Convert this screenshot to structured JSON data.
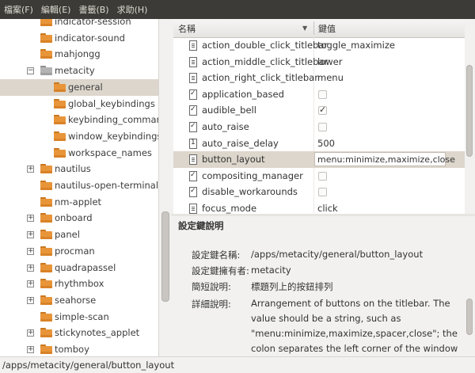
{
  "menu": [
    "檔案(F)",
    "編輯(E)",
    "書籤(B)",
    "求助(H)"
  ],
  "tree": [
    {
      "label": "indicator-session",
      "depth": 1,
      "expander": "none",
      "folder": "orange",
      "selected": false
    },
    {
      "label": "indicator-sound",
      "depth": 1,
      "expander": "none",
      "folder": "orange",
      "selected": false
    },
    {
      "label": "mahjongg",
      "depth": 1,
      "expander": "none",
      "folder": "orange",
      "selected": false
    },
    {
      "label": "metacity",
      "depth": 1,
      "expander": "minus",
      "folder": "gray",
      "selected": false
    },
    {
      "label": "general",
      "depth": 2,
      "expander": "none",
      "folder": "orange",
      "selected": true
    },
    {
      "label": "global_keybindings",
      "depth": 2,
      "expander": "none",
      "folder": "orange",
      "selected": false
    },
    {
      "label": "keybinding_commands",
      "depth": 2,
      "expander": "none",
      "folder": "orange",
      "selected": false
    },
    {
      "label": "window_keybindings",
      "depth": 2,
      "expander": "none",
      "folder": "orange",
      "selected": false
    },
    {
      "label": "workspace_names",
      "depth": 2,
      "expander": "none",
      "folder": "orange",
      "selected": false
    },
    {
      "label": "nautilus",
      "depth": 1,
      "expander": "plus",
      "folder": "orange",
      "selected": false
    },
    {
      "label": "nautilus-open-terminal",
      "depth": 1,
      "expander": "none",
      "folder": "orange",
      "selected": false
    },
    {
      "label": "nm-applet",
      "depth": 1,
      "expander": "none",
      "folder": "orange",
      "selected": false
    },
    {
      "label": "onboard",
      "depth": 1,
      "expander": "plus",
      "folder": "orange",
      "selected": false
    },
    {
      "label": "panel",
      "depth": 1,
      "expander": "plus",
      "folder": "orange",
      "selected": false
    },
    {
      "label": "procman",
      "depth": 1,
      "expander": "plus",
      "folder": "orange",
      "selected": false
    },
    {
      "label": "quadrapassel",
      "depth": 1,
      "expander": "plus",
      "folder": "orange",
      "selected": false
    },
    {
      "label": "rhythmbox",
      "depth": 1,
      "expander": "plus",
      "folder": "orange",
      "selected": false
    },
    {
      "label": "seahorse",
      "depth": 1,
      "expander": "plus",
      "folder": "orange",
      "selected": false
    },
    {
      "label": "simple-scan",
      "depth": 1,
      "expander": "none",
      "folder": "orange",
      "selected": false
    },
    {
      "label": "stickynotes_applet",
      "depth": 1,
      "expander": "plus",
      "folder": "orange",
      "selected": false
    },
    {
      "label": "tomboy",
      "depth": 1,
      "expander": "plus",
      "folder": "orange",
      "selected": false
    }
  ],
  "table": {
    "header_name": "名稱",
    "header_value": "鍵值",
    "rows": [
      {
        "icon": "list-icon",
        "key": "action_double_click_titlebar",
        "type": "text",
        "value": "toggle_maximize",
        "selected": false
      },
      {
        "icon": "list-icon",
        "key": "action_middle_click_titlebar",
        "type": "text",
        "value": "lower",
        "selected": false
      },
      {
        "icon": "list-icon",
        "key": "action_right_click_titlebar",
        "type": "text",
        "value": "menu",
        "selected": false
      },
      {
        "icon": "check-icon",
        "key": "application_based",
        "type": "bool",
        "value": false,
        "selected": false
      },
      {
        "icon": "check-icon",
        "key": "audible_bell",
        "type": "bool",
        "value": true,
        "selected": false
      },
      {
        "icon": "check-icon",
        "key": "auto_raise",
        "type": "bool",
        "value": false,
        "selected": false
      },
      {
        "icon": "number-icon",
        "key": "auto_raise_delay",
        "type": "text",
        "value": "500",
        "selected": false
      },
      {
        "icon": "list-icon",
        "key": "button_layout",
        "type": "edit",
        "value": "menu:minimize,maximize,close",
        "selected": true
      },
      {
        "icon": "check-icon",
        "key": "compositing_manager",
        "type": "bool",
        "value": false,
        "selected": false
      },
      {
        "icon": "check-icon",
        "key": "disable_workarounds",
        "type": "bool",
        "value": false,
        "selected": false
      },
      {
        "icon": "list-icon",
        "key": "focus_mode",
        "type": "text",
        "value": "click",
        "selected": false
      }
    ]
  },
  "description": {
    "title": "設定鍵說明",
    "key_name_label": "設定鍵名稱:",
    "key_name": "/apps/metacity/general/button_layout",
    "owner_label": "設定鍵擁有者:",
    "owner": "metacity",
    "short_label": "簡短說明:",
    "short": "標題列上的按鈕排列",
    "long_label": "詳細說明:",
    "long": "Arrangement of buttons on the titlebar. The value should be a string, such as \"menu:minimize,maximize,spacer,close\"; the colon separates the left corner of the window from the right corner, and the button names are comma-"
  },
  "status": "/apps/metacity/general/button_layout"
}
